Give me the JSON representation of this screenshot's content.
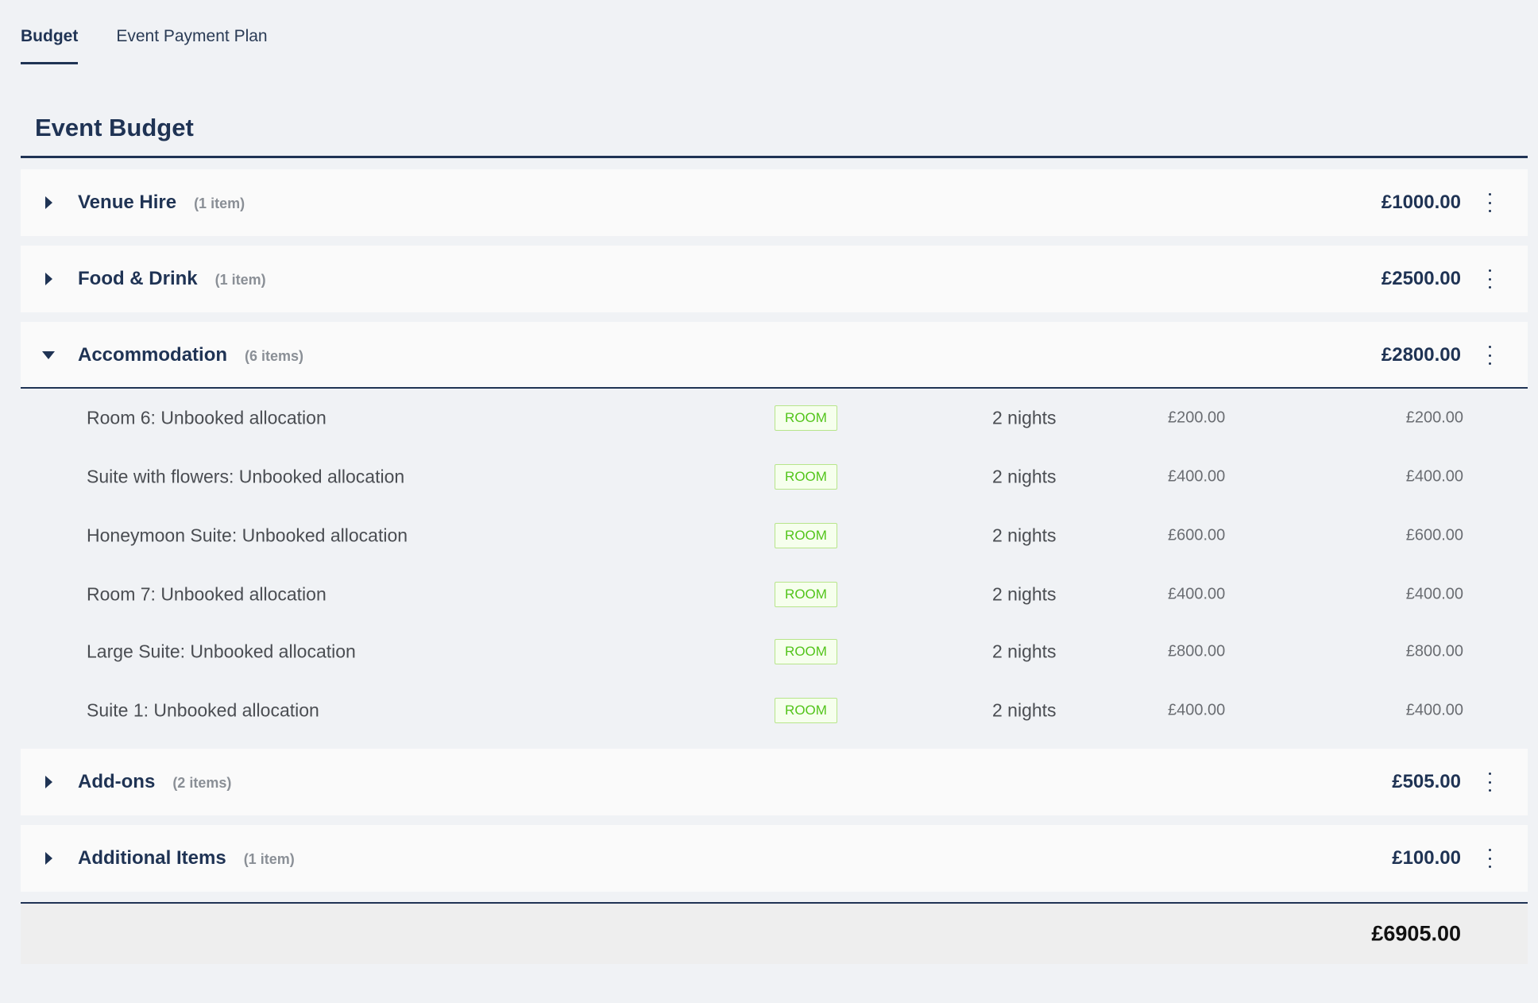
{
  "tabs": [
    {
      "label": "Budget",
      "active": true
    },
    {
      "label": "Event Payment Plan",
      "active": false
    }
  ],
  "page_title": "Event Budget",
  "categories": [
    {
      "name": "Venue Hire",
      "count": "(1 item)",
      "total": "£1000.00",
      "expanded": false
    },
    {
      "name": "Food & Drink",
      "count": "(1 item)",
      "total": "£2500.00",
      "expanded": false
    },
    {
      "name": "Accommodation",
      "count": "(6 items)",
      "total": "£2800.00",
      "expanded": true,
      "items": [
        {
          "name": "Room 6: Unbooked allocation",
          "badge": "ROOM",
          "nights": "2  nights",
          "unit_price": "£200.00",
          "total": "£200.00"
        },
        {
          "name": "Suite with flowers: Unbooked allocation",
          "badge": "ROOM",
          "nights": "2  nights",
          "unit_price": "£400.00",
          "total": "£400.00"
        },
        {
          "name": "Honeymoon Suite: Unbooked allocation",
          "badge": "ROOM",
          "nights": "2  nights",
          "unit_price": "£600.00",
          "total": "£600.00"
        },
        {
          "name": "Room 7: Unbooked allocation",
          "badge": "ROOM",
          "nights": "2  nights",
          "unit_price": "£400.00",
          "total": "£400.00"
        },
        {
          "name": "Large Suite: Unbooked allocation",
          "badge": "ROOM",
          "nights": "2  nights",
          "unit_price": "£800.00",
          "total": "£800.00"
        },
        {
          "name": "Suite 1: Unbooked allocation",
          "badge": "ROOM",
          "nights": "2  nights",
          "unit_price": "£400.00",
          "total": "£400.00"
        }
      ]
    },
    {
      "name": "Add-ons",
      "count": "(2 items)",
      "total": "£505.00",
      "expanded": false
    },
    {
      "name": "Additional Items",
      "count": "(1 item)",
      "total": "£100.00",
      "expanded": false
    }
  ],
  "grand_total": "£6905.00",
  "colors": {
    "primary": "#1f3354",
    "badge_green": "#52c41a",
    "background": "#f0f2f5"
  }
}
